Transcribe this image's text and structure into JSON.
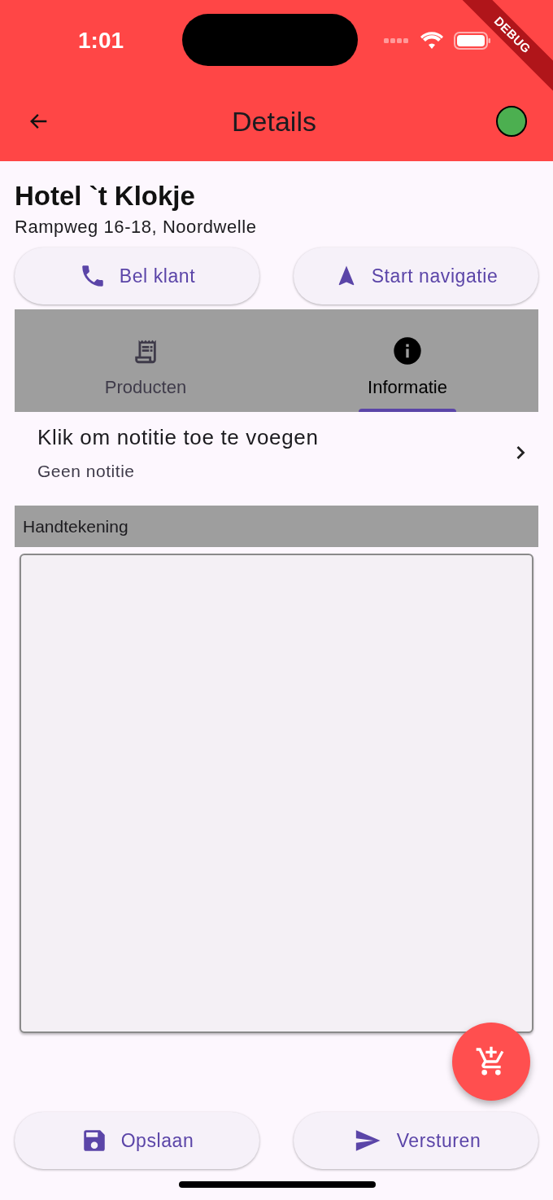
{
  "status_bar": {
    "time": "1:01"
  },
  "debug_banner": "DEBUG",
  "app_bar": {
    "title": "Details",
    "online": true
  },
  "customer": {
    "name": "Hotel `t Klokje",
    "address": "Rampweg 16-18, Noordwelle"
  },
  "actions": [
    {
      "kind": "phone",
      "label": "Bel klant"
    },
    {
      "kind": "navigate",
      "label": "Start navigatie"
    }
  ],
  "tabs": [
    {
      "kind": "products",
      "label": "Producten",
      "selected": false
    },
    {
      "kind": "info",
      "label": "Informatie",
      "selected": true
    }
  ],
  "note": {
    "title": "Klik om notitie toe te voegen",
    "subtitle": "Geen notitie"
  },
  "signature": {
    "header": "Handtekening"
  },
  "footer_buttons": [
    {
      "kind": "save",
      "label": "Opslaan"
    },
    {
      "kind": "send",
      "label": "Versturen"
    }
  ]
}
